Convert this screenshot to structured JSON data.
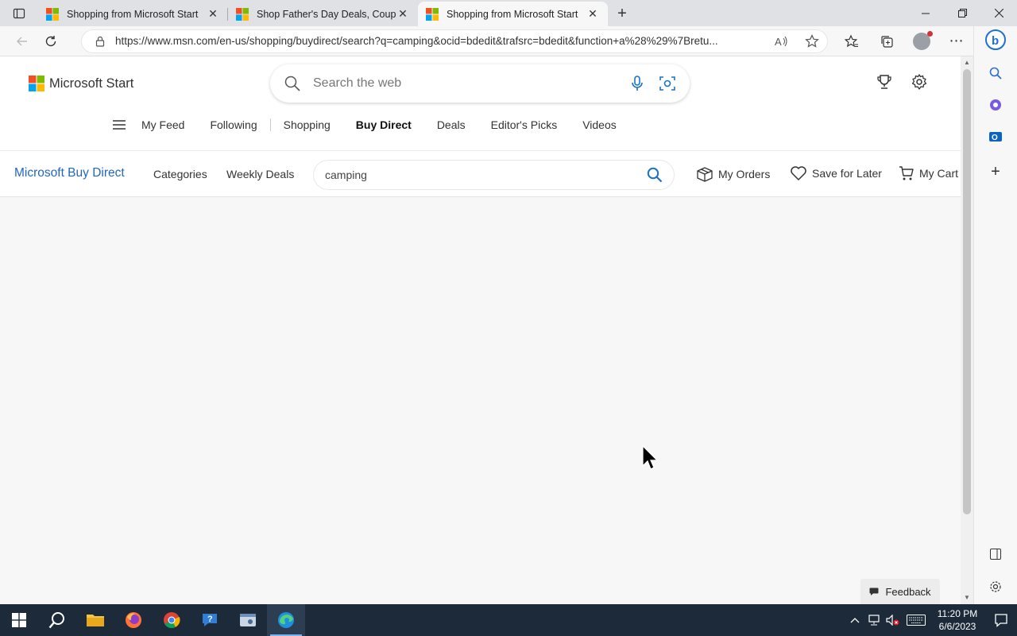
{
  "browser": {
    "tabs": [
      {
        "title": "Shopping from Microsoft Start",
        "active": false
      },
      {
        "title": "Shop Father's Day Deals, Coupons",
        "active": false
      },
      {
        "title": "Shopping from Microsoft Start",
        "active": true
      }
    ],
    "url": "https://www.msn.com/en-us/shopping/buydirect/search?q=camping&ocid=bdedit&trafsrc=bdedit&function+a%28%29%7Bretu..."
  },
  "header": {
    "brand": "Microsoft Start",
    "search_placeholder": "Search the web"
  },
  "nav": {
    "items": [
      "My Feed",
      "Following",
      "Shopping",
      "Buy Direct",
      "Deals",
      "Editor's Picks",
      "Videos"
    ],
    "active": "Buy Direct"
  },
  "buydirect": {
    "brand": "Microsoft Buy Direct",
    "categories": "Categories",
    "weekly_deals": "Weekly Deals",
    "search_value": "camping",
    "my_orders": "My Orders",
    "save_for_later": "Save for Later",
    "my_cart": "My Cart"
  },
  "feedback": "Feedback",
  "taskbar": {
    "time": "11:20 PM",
    "date": "6/6/2023"
  },
  "colors": {
    "accent": "#2266c2",
    "taskbar": "#1c2a3a"
  }
}
